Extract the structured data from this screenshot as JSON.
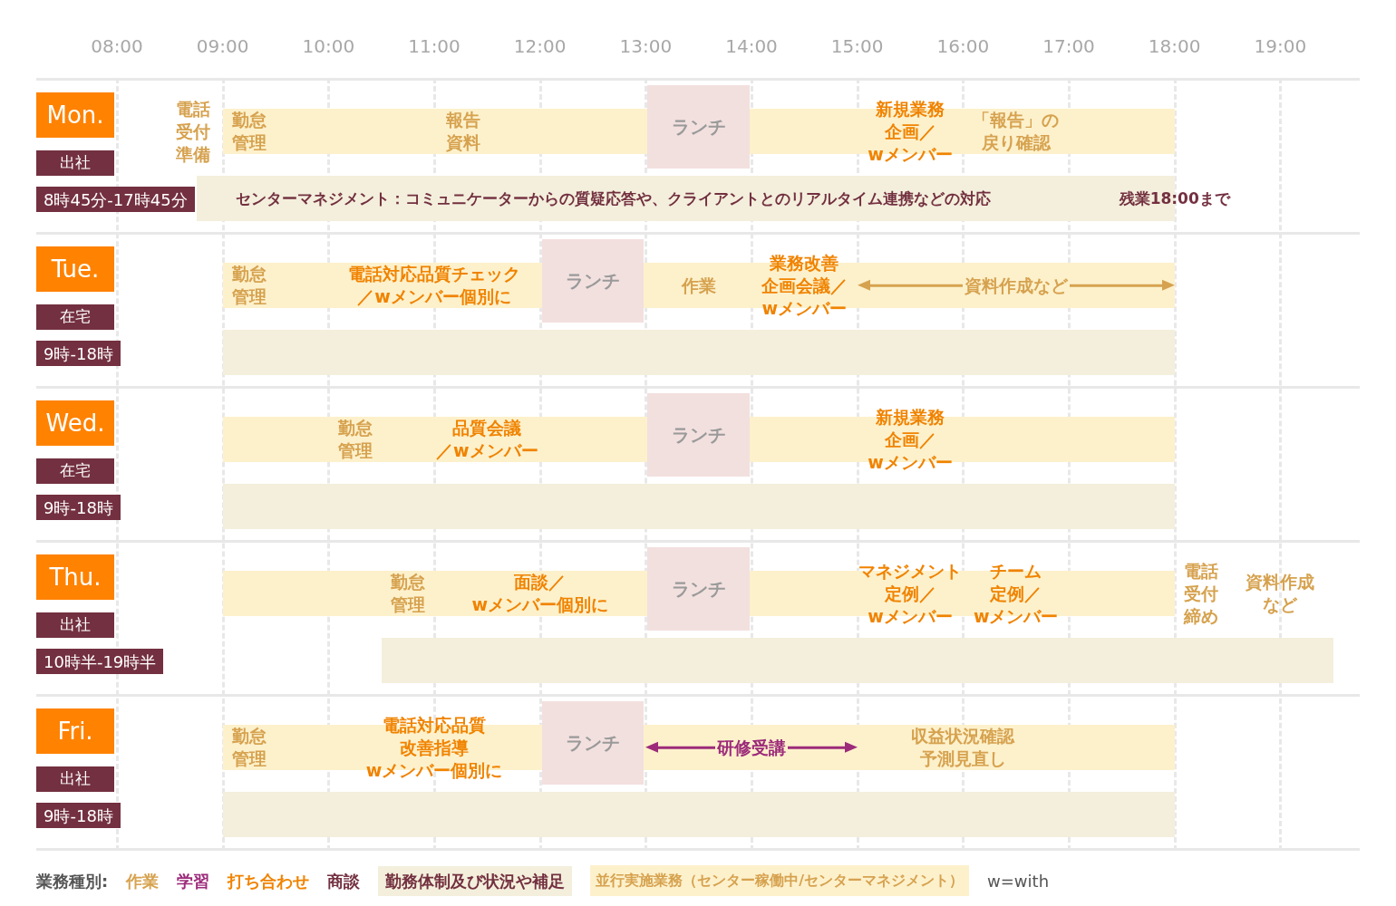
{
  "time_axis": [
    "08:00",
    "09:00",
    "10:00",
    "11:00",
    "12:00",
    "13:00",
    "14:00",
    "15:00",
    "16:00",
    "17:00",
    "18:00",
    "19:00"
  ],
  "days": [
    {
      "day": "Mon.",
      "status": "出社",
      "hours": "8時45分-17時45分",
      "items": [
        {
          "kind": "label",
          "color": "#d6a24f",
          "lines": [
            "電話",
            "受付",
            "準備"
          ]
        },
        {
          "kind": "label",
          "color": "#d6a24f",
          "lines": [
            "勤怠",
            "管理"
          ]
        },
        {
          "kind": "label",
          "color": "#d6a24f",
          "lines": [
            "報告",
            "資料"
          ]
        },
        {
          "kind": "lunch",
          "text": "ランチ"
        },
        {
          "kind": "label",
          "color": "#f08300",
          "lines": [
            "新規業務",
            "企画／",
            "wメンバー"
          ]
        },
        {
          "kind": "label",
          "color": "#d6a24f",
          "lines": [
            "「報告」の",
            "戻り確認"
          ]
        },
        {
          "kind": "label",
          "color": "#733040",
          "lines": [
            "センターマネジメント：コミュニケーターからの質疑応答や、クライアントとのリアルタイム連携などの対応"
          ]
        },
        {
          "kind": "label",
          "color": "#733040",
          "lines": [
            "残業18:00まで"
          ]
        }
      ]
    },
    {
      "day": "Tue.",
      "status": "在宅",
      "hours": "9時-18時",
      "items": [
        {
          "kind": "label",
          "color": "#d6a24f",
          "lines": [
            "勤怠",
            "管理"
          ]
        },
        {
          "kind": "label",
          "color": "#f08300",
          "lines": [
            "電話対応品質チェック",
            "／wメンバー個別に"
          ]
        },
        {
          "kind": "lunch",
          "text": "ランチ"
        },
        {
          "kind": "label",
          "color": "#d6a24f",
          "lines": [
            "作業"
          ]
        },
        {
          "kind": "label",
          "color": "#f08300",
          "lines": [
            "業務改善",
            "企画会議／",
            "wメンバー"
          ]
        },
        {
          "kind": "arrow",
          "color": "#d6a24f",
          "text": "資料作成など"
        }
      ]
    },
    {
      "day": "Wed.",
      "status": "在宅",
      "hours": "9時-18時",
      "items": [
        {
          "kind": "label",
          "color": "#d6a24f",
          "lines": [
            "勤怠",
            "管理"
          ]
        },
        {
          "kind": "label",
          "color": "#f08300",
          "lines": [
            "品質会議",
            "／wメンバー"
          ]
        },
        {
          "kind": "lunch",
          "text": "ランチ"
        },
        {
          "kind": "label",
          "color": "#f08300",
          "lines": [
            "新規業務",
            "企画／",
            "wメンバー"
          ]
        }
      ]
    },
    {
      "day": "Thu.",
      "status": "出社",
      "hours": "10時半-19時半",
      "items": [
        {
          "kind": "label",
          "color": "#d6a24f",
          "lines": [
            "勤怠",
            "管理"
          ]
        },
        {
          "kind": "label",
          "color": "#f08300",
          "lines": [
            "面談／",
            "wメンバー個別に"
          ]
        },
        {
          "kind": "lunch",
          "text": "ランチ"
        },
        {
          "kind": "label",
          "color": "#f08300",
          "lines": [
            "マネジメント",
            "定例／",
            "wメンバー"
          ]
        },
        {
          "kind": "label",
          "color": "#f08300",
          "lines": [
            "チーム",
            "定例／",
            "wメンバー"
          ]
        },
        {
          "kind": "label",
          "color": "#d6a24f",
          "lines": [
            "電話",
            "受付",
            "締め"
          ]
        },
        {
          "kind": "label",
          "color": "#d6a24f",
          "lines": [
            "資料作成",
            "など"
          ]
        }
      ]
    },
    {
      "day": "Fri.",
      "status": "出社",
      "hours": "9時-18時",
      "items": [
        {
          "kind": "label",
          "color": "#d6a24f",
          "lines": [
            "勤怠",
            "管理"
          ]
        },
        {
          "kind": "label",
          "color": "#f08300",
          "lines": [
            "電話対応品質",
            "改善指導",
            "wメンバー個別に"
          ]
        },
        {
          "kind": "lunch",
          "text": "ランチ"
        },
        {
          "kind": "arrow",
          "color": "#9c2b7a",
          "text": "研修受講"
        },
        {
          "kind": "label",
          "color": "#d6a24f",
          "lines": [
            "収益状況確認",
            "予測見直し"
          ]
        }
      ]
    }
  ],
  "legend": {
    "title": "業務種別:",
    "items": [
      {
        "kind": "category",
        "text": "作業",
        "color": "#d6a24f"
      },
      {
        "kind": "category",
        "text": "学習",
        "color": "#9c2b7a"
      },
      {
        "kind": "category",
        "text": "打ち合わせ",
        "color": "#f08300"
      },
      {
        "kind": "category",
        "text": "商談",
        "color": "#733040"
      },
      {
        "kind": "support_band",
        "text": "勤務体制及び状況や補足"
      },
      {
        "kind": "activity_band",
        "text": "並行実施業務（センター稼働中/センターマネジメント）"
      },
      {
        "kind": "note",
        "text": "w=with"
      }
    ]
  }
}
